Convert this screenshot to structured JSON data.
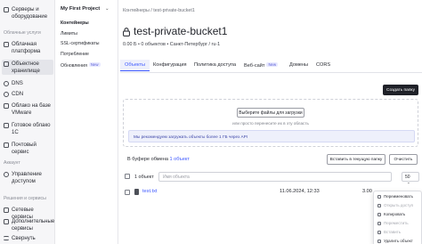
{
  "nav": {
    "items": [
      {
        "label": "Серверы и оборудование"
      },
      {
        "label": "Облачная платформа"
      },
      {
        "label": "Объектное хранилище"
      },
      {
        "label": "DNS"
      },
      {
        "label": "CDN"
      },
      {
        "label": "Облако на базе VMware"
      },
      {
        "label": "Готовое облако 1С"
      },
      {
        "label": "Почтовый сервис"
      },
      {
        "label": "Управление доступом"
      },
      {
        "label": "Сетевые сервисы"
      },
      {
        "label": "Дополнительные сервисы"
      },
      {
        "label": "Свернуть"
      }
    ],
    "groups": {
      "cloud": "Облачные услуги",
      "account": "Аккаунт",
      "solutions": "Решения и сервисы"
    }
  },
  "subnav": {
    "project": "My First Project",
    "items": [
      {
        "label": "Контейнеры"
      },
      {
        "label": "Лимиты"
      },
      {
        "label": "SSL-сертификаты"
      },
      {
        "label": "Потребление"
      },
      {
        "label": "Обновления",
        "badge": "New"
      }
    ]
  },
  "breadcrumb": "Контейнеры / test-private-bucket1",
  "title": "test-private-bucket1",
  "meta": "0.00 Б • 0 объектов • Санкт-Петербург / ru-1",
  "tabs": [
    {
      "label": "Объекты"
    },
    {
      "label": "Конфигурация"
    },
    {
      "label": "Политика доступа"
    },
    {
      "label": "Веб-сайт",
      "badge": "New"
    },
    {
      "label": "Домены"
    },
    {
      "label": "CORS"
    }
  ],
  "create_folder": "Создать папку",
  "upload": {
    "button": "Выберите файлы для загрузки",
    "hint": "или просто перенесите их в эту область",
    "info": "Мы рекомендуем загружать объекты более 1 ГБ через API"
  },
  "clipboard": {
    "prefix": "В буфере обмена",
    "count_link": "1 объект",
    "paste_here": "Вставить в текущую папку",
    "clear": "Очистить"
  },
  "list": {
    "selected": "1 объект",
    "search_placeholder": "Имя объекта",
    "per_page": "50",
    "rows": [
      {
        "name": "test.txt",
        "date": "11.06.2024, 12:33",
        "size": "3.00"
      }
    ]
  },
  "context_menu": {
    "items": [
      {
        "label": "Переименовать",
        "disabled": false
      },
      {
        "label": "Открыть доступ",
        "disabled": true
      },
      {
        "label": "Копировать",
        "disabled": false
      },
      {
        "label": "Переместить",
        "disabled": true
      },
      {
        "label": "Вставить",
        "disabled": true
      },
      {
        "label": "Удалить объект",
        "disabled": false
      }
    ]
  },
  "colors": {
    "accent": "#3e59ff",
    "dark_button": "#1f2128",
    "nav_bg": "#f6f6f8"
  }
}
